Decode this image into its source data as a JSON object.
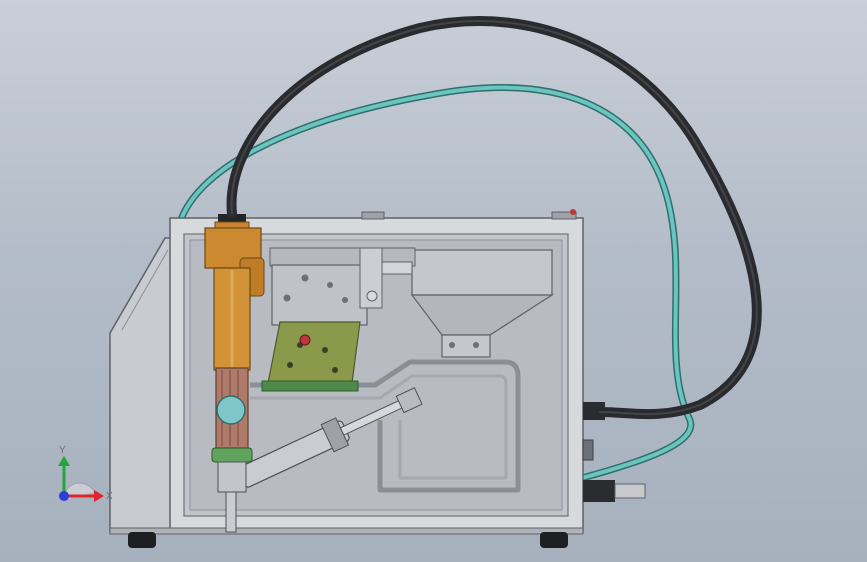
{
  "viewport": {
    "background_top": "#c9cfd8",
    "background_bottom": "#a7b1be"
  },
  "axis_triad": {
    "y_label": "Y",
    "x_label": "X",
    "colors": {
      "x": "#e0242b",
      "y": "#24a53a",
      "z": "#2b3fd8"
    }
  },
  "model": {
    "cable_color": "#2a2b2e",
    "hose_color": "#5fb9b5",
    "body_color": "#d4d6da",
    "window_color": "#bcc0c6",
    "cylinder_color": "#c9852d",
    "bracket_color": "#4f8a4a",
    "hopper_color": "#b9bcc1"
  }
}
